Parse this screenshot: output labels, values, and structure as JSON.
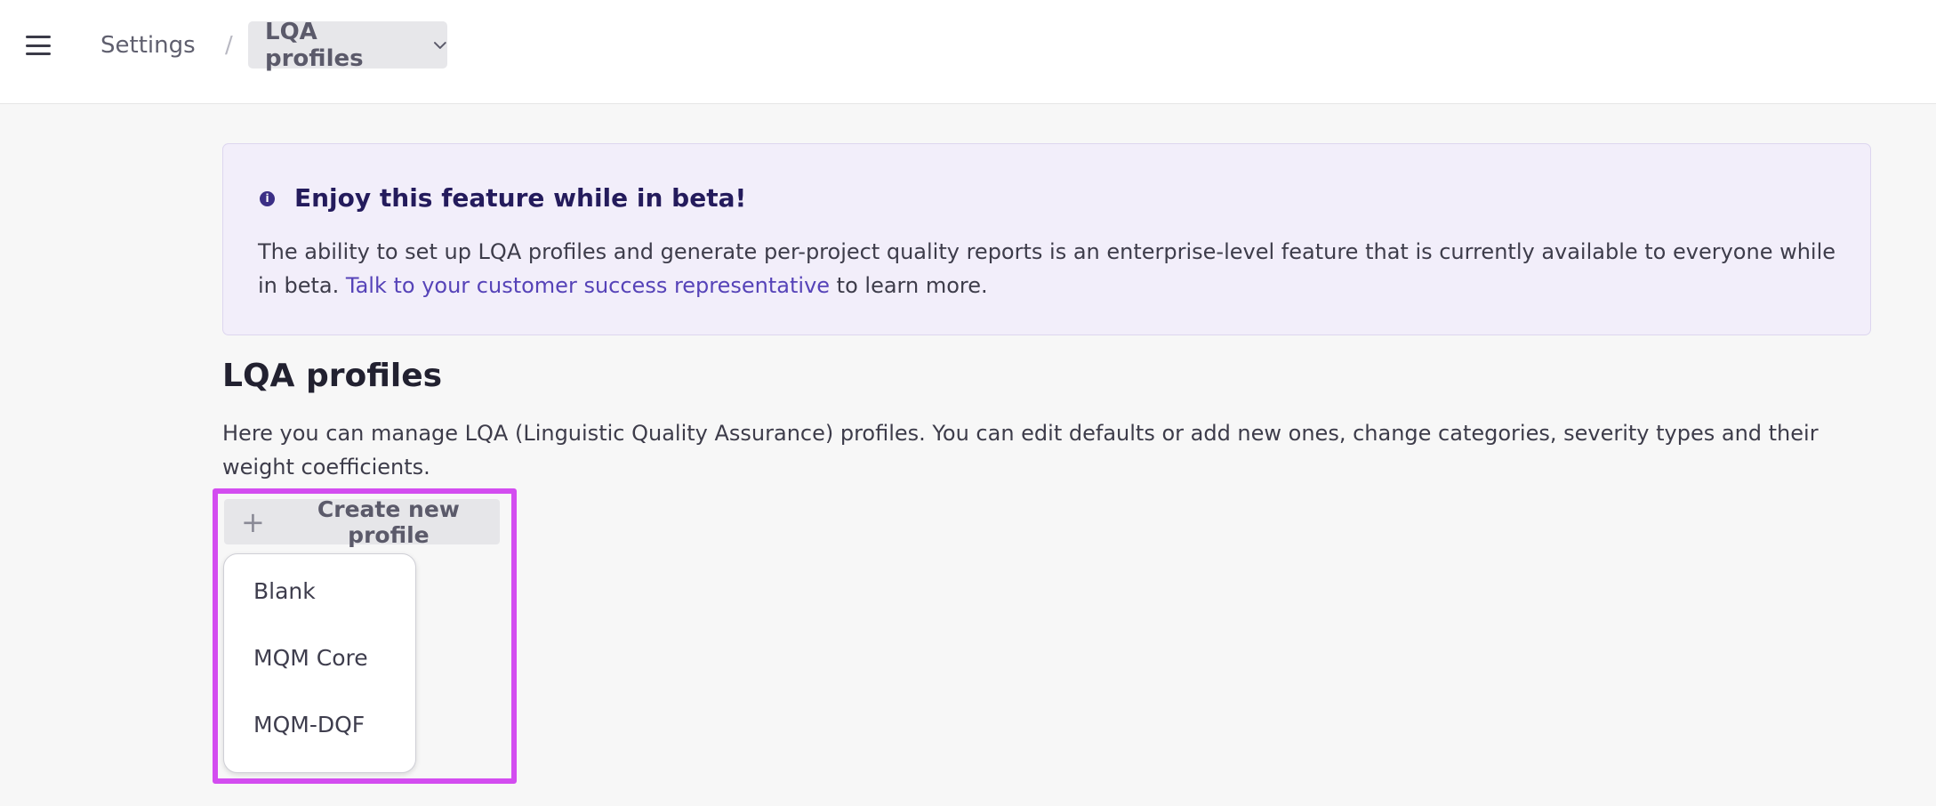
{
  "header": {
    "menu_icon": "hamburger-icon",
    "breadcrumb": {
      "parent": "Settings",
      "separator": "/",
      "current": "LQA profiles",
      "current_icon": "chevron-down-icon"
    }
  },
  "beta_notice": {
    "icon": "info-icon",
    "icon_glyph": "i",
    "title": "Enjoy this feature while in beta!",
    "text_before": "The ability to set up LQA profiles and generate per-project quality reports is an enterprise-level feature that is currently available to everyone while in beta. ",
    "link_text": "Talk to your customer success representative",
    "text_after": " to learn more."
  },
  "section": {
    "title": "LQA profiles",
    "description": "Here you can manage LQA (Linguistic Quality Assurance) profiles. You can edit defaults or add new ones, change categories, severity types and their weight coefficients."
  },
  "create_button": {
    "icon": "plus-icon",
    "icon_glyph": "+",
    "label": "Create new profile"
  },
  "dropdown": {
    "items": [
      "Blank",
      "MQM Core",
      "MQM-DQF"
    ]
  },
  "colors": {
    "accent": "#5643b8",
    "highlight": "#d34df0",
    "beta_bg": "#f2eefa"
  }
}
